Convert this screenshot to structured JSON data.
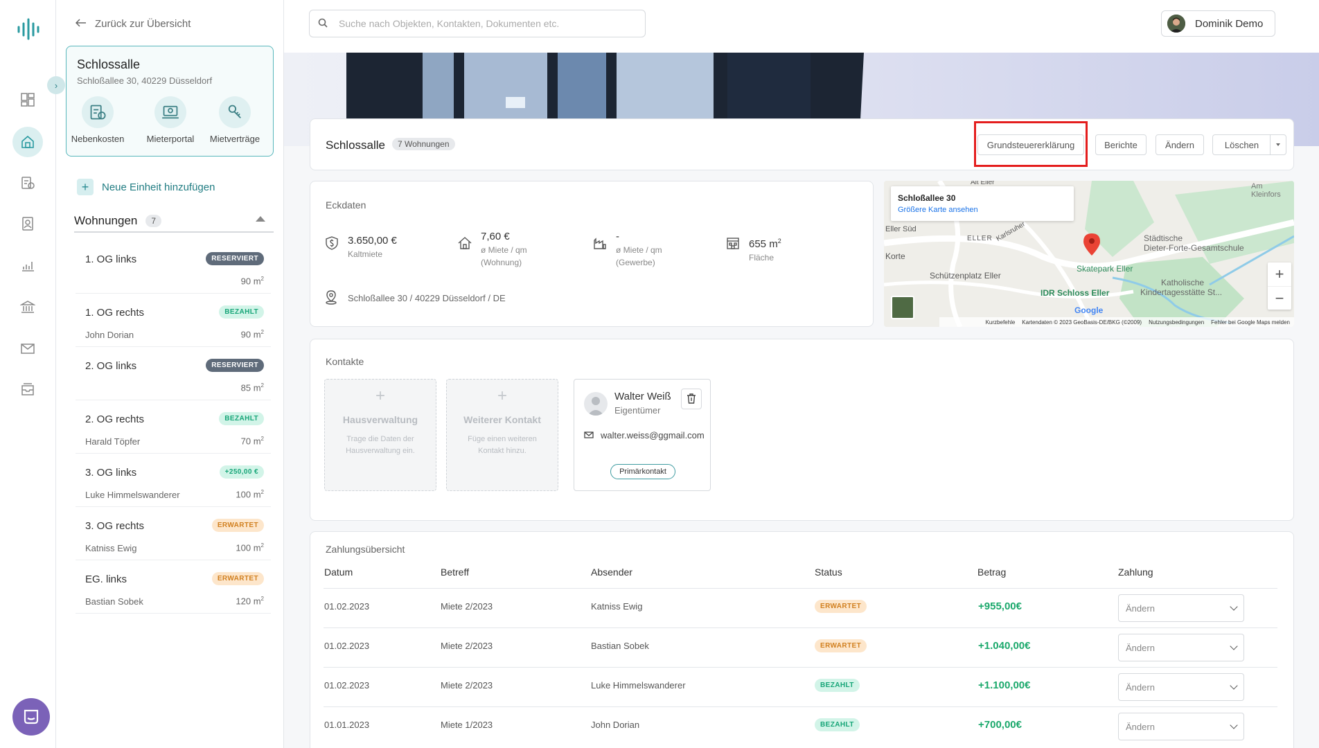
{
  "nav": {
    "back_label": "Zurück zur Übersicht",
    "icons": [
      "logo-icon",
      "dashboard-icon",
      "home-icon",
      "costs-icon",
      "contacts-icon",
      "reports-icon",
      "bank-icon",
      "mail-icon",
      "inbox-icon",
      "chat-icon"
    ]
  },
  "property": {
    "name": "Schlossalle",
    "address": "Schloßallee 30, 40229 Düsseldorf",
    "actions": [
      {
        "label": "Nebenkosten",
        "icon": "costs-icon"
      },
      {
        "label": "Mieterportal",
        "icon": "portal-icon"
      },
      {
        "label": "Mietverträge",
        "icon": "contract-icon"
      }
    ]
  },
  "sidebar": {
    "add_unit": "Neue Einheit hinzufügen",
    "units_title": "Wohnungen",
    "units_count": "7",
    "units": [
      {
        "name": "1. OG links",
        "tenant": "",
        "badge": "RESERVIERT",
        "badge_type": "res",
        "size": "90 m",
        "unit_sup": "2"
      },
      {
        "name": "1. OG rechts",
        "tenant": "John Dorian",
        "badge": "BEZAHLT",
        "badge_type": "bez",
        "size": "90 m",
        "unit_sup": "2"
      },
      {
        "name": "2. OG links",
        "tenant": "",
        "badge": "RESERVIERT",
        "badge_type": "res",
        "size": "85 m",
        "unit_sup": "2"
      },
      {
        "name": "2. OG rechts",
        "tenant": "Harald Töpfer",
        "badge": "BEZAHLT",
        "badge_type": "bez",
        "size": "70 m",
        "unit_sup": "2"
      },
      {
        "name": "3. OG links",
        "tenant": "Luke Himmelswanderer",
        "badge": "+250,00 €",
        "badge_type": "bez",
        "size": "100 m",
        "unit_sup": "2"
      },
      {
        "name": "3. OG rechts",
        "tenant": "Katniss Ewig",
        "badge": "ERWARTET",
        "badge_type": "erw",
        "size": "100 m",
        "unit_sup": "2"
      },
      {
        "name": "EG. links",
        "tenant": "Bastian Sobek",
        "badge": "ERWARTET",
        "badge_type": "erw",
        "size": "120 m",
        "unit_sup": "2"
      }
    ]
  },
  "search": {
    "placeholder": "Suche nach Objekten, Kontakten, Dokumenten etc."
  },
  "user": {
    "name": "Dominik Demo"
  },
  "header": {
    "title": "Schlossalle",
    "count": "7 Wohnungen",
    "buttons": {
      "tax": "Grundsteuererklärung",
      "reports": "Berichte",
      "edit": "Ändern",
      "delete": "Löschen"
    }
  },
  "eckdaten": {
    "title": "Eckdaten",
    "facts": [
      {
        "value": "3.650,00 €",
        "sub1": "Kaltmiete",
        "sub2": "",
        "icon": "money-icon"
      },
      {
        "value": "7,60 €",
        "sub1": "ø Miete / qm",
        "sub2": "(Wohnung)",
        "icon": "house-icon"
      },
      {
        "value": "-",
        "sub1": "ø Miete / qm",
        "sub2": "(Gewerbe)",
        "icon": "factory-icon"
      },
      {
        "value": "655 m",
        "value_sup": "2",
        "sub1": "Fläche",
        "sub2": "",
        "icon": "building-icon"
      }
    ],
    "address": "Schloßallee 30 / 40229 Düsseldorf / DE"
  },
  "map": {
    "title": "Schloßallee 30",
    "link": "Größere Karte ansehen",
    "labels": [
      "Alt Eller",
      "Eller Süd",
      "ELLER",
      "Karlsruher",
      "Korte",
      "Schützenplatz Eller",
      "Skatepark Eller",
      "IDR Schloss Eller",
      "Städtische",
      "Dieter-Forte-Gesamtschule",
      "Katholische",
      "Kindertagesstätte St...",
      "Am Kleinfors",
      "Google"
    ],
    "footer": [
      "Kurzbefehle",
      "Kartendaten © 2023 GeoBasis-DE/BKG (©2009)",
      "Nutzungsbedingungen",
      "Fehler bei Google Maps melden"
    ]
  },
  "kontakte": {
    "title": "Kontakte",
    "add_cards": [
      {
        "title": "Hausverwaltung",
        "desc": "Trage die Daten der Hausverwaltung ein."
      },
      {
        "title": "Weiterer Kontakt",
        "desc": "Füge einen weiteren Kontakt hinzu."
      }
    ],
    "contact": {
      "name": "Walter Weiß",
      "role": "Eigentümer",
      "email": "walter.weiss@ggmail.com",
      "badge": "Primärkontakt"
    }
  },
  "payments": {
    "title": "Zahlungsübersicht",
    "headers": [
      "Datum",
      "Betreff",
      "Absender",
      "Status",
      "Betrag",
      "Zahlung"
    ],
    "rows": [
      {
        "date": "01.02.2023",
        "subject": "Miete 2/2023",
        "sender": "Katniss Ewig",
        "status": "ERWARTET",
        "status_type": "erw",
        "amount": "+955,00€",
        "action": "Ändern"
      },
      {
        "date": "01.02.2023",
        "subject": "Miete 2/2023",
        "sender": "Bastian Sobek",
        "status": "ERWARTET",
        "status_type": "erw",
        "amount": "+1.040,00€",
        "action": "Ändern"
      },
      {
        "date": "01.02.2023",
        "subject": "Miete 2/2023",
        "sender": "Luke Himmelswanderer",
        "status": "BEZAHLT",
        "status_type": "bez",
        "amount": "+1.100,00€",
        "action": "Ändern"
      },
      {
        "date": "01.01.2023",
        "subject": "Miete 1/2023",
        "sender": "John Dorian",
        "status": "BEZAHLT",
        "status_type": "bez",
        "amount": "+700,00€",
        "action": "Ändern"
      }
    ]
  },
  "colors": {
    "accent": "#2a8c92",
    "highlight": "#e41d1d",
    "positive": "#1aa86b"
  }
}
